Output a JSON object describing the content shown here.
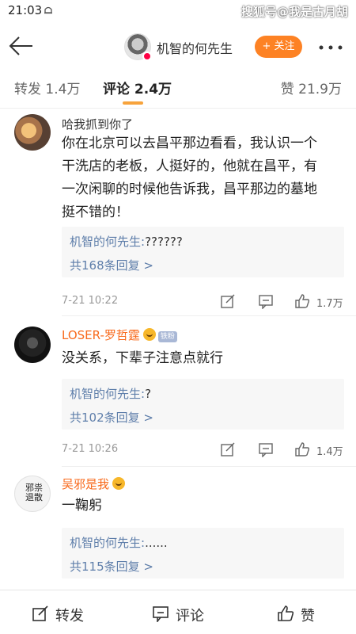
{
  "status": {
    "time": "21:03",
    "watermark": "搜狐号@我是古月胡"
  },
  "nav": {
    "title": "机智的何先生",
    "follow_label": "+ 关注"
  },
  "tabs": {
    "repost": "转发 1.4万",
    "comment": "评论 2.4万",
    "like": "赞 21.9万"
  },
  "comments": [
    {
      "user": "哈我抓到你了",
      "avatar_text": "",
      "text": [
        "你在北京可以去昌平那边看看，我认识一个",
        "干洗店的老板，人挺好的，他就在昌平，有",
        "一次闲聊的时候他告诉我，昌平那边的墓地",
        "挺不错的！"
      ],
      "reply": {
        "author": "机智的何先生:",
        "content": "??????"
      },
      "reply_count": "共168条回复 >",
      "time": "7-21 10:22",
      "likes": "1.7万"
    },
    {
      "user": "LOSER-罗哲霆",
      "fan_badge": "铁粉",
      "text": [
        "没关系，下辈子注意点就行"
      ],
      "reply": {
        "author": "机智的何先生:",
        "content": "?"
      },
      "reply_count": "共102条回复 >",
      "time": "7-21 10:26",
      "likes": "1.4万"
    },
    {
      "user": "吴邪是我",
      "avatar_text": "邪祟退散",
      "text": [
        "一鞠躬"
      ],
      "reply": {
        "author": "机智的何先生:",
        "content": "......"
      },
      "reply_count": "共115条回复 >"
    }
  ],
  "bottom": {
    "repost": "转发",
    "comment": "评论",
    "like": "赞"
  },
  "colors": {
    "accent": "#fd8224",
    "link": "#5e7eaa",
    "vip_name": "#f86a1c"
  }
}
